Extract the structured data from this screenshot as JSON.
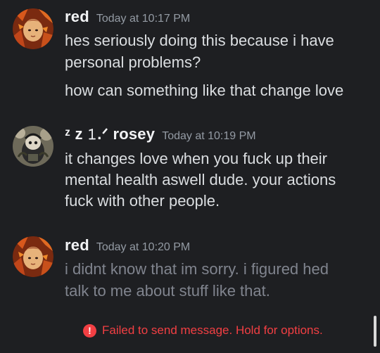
{
  "messages": [
    {
      "username": "red",
      "timestamp": "Today at 10:17 PM",
      "lines": [
        "hes seriously doing this because i have",
        "personal problems?",
        "how can something like that change love"
      ]
    },
    {
      "username": "ᶻ z 𝟷.ᐟ rosey",
      "timestamp": "Today at 10:19 PM",
      "lines": [
        "it changes love when you fuck up their",
        "mental health aswell dude. your actions",
        "fuck with other people."
      ]
    },
    {
      "username": "red",
      "timestamp": "Today at 10:20 PM",
      "lines": [
        "i didnt know that im sorry. i figured hed",
        "talk to me about stuff like that."
      ]
    }
  ],
  "error": {
    "icon": "!",
    "text": "Failed to send message. Hold for options."
  },
  "colors": {
    "background": "#1e1f22",
    "error": "#f23f43",
    "pending_text": "#80848e"
  },
  "icons": {
    "error": "error-circle-icon"
  }
}
